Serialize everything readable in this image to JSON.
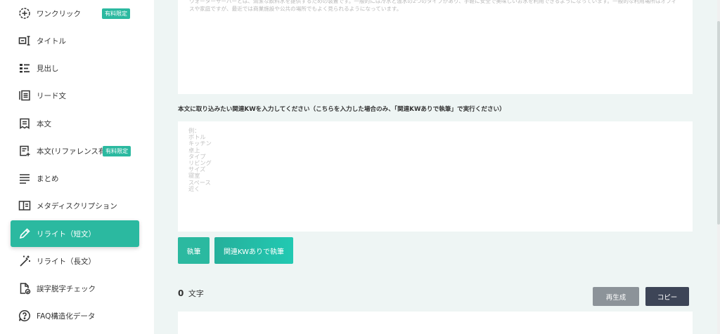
{
  "sidebar": {
    "items": [
      {
        "label": "ワンクリック",
        "icon": "plus-circle-icon",
        "badge": "有料限定"
      },
      {
        "label": "タイトル",
        "icon": "title-icon"
      },
      {
        "label": "見出し",
        "icon": "heading-list-icon"
      },
      {
        "label": "リード文",
        "icon": "lead-text-icon"
      },
      {
        "label": "本文",
        "icon": "document-icon"
      },
      {
        "label": "本文(リファレンス有)",
        "icon": "document-add-icon",
        "badge": "有料限定"
      },
      {
        "label": "まとめ",
        "icon": "summary-lines-icon"
      },
      {
        "label": "メタディスクリプション",
        "icon": "meta-description-icon"
      },
      {
        "label": "リライト（短文）",
        "icon": "pencil-icon",
        "active": true
      },
      {
        "label": "リライト（長文）",
        "icon": "magic-wand-icon"
      },
      {
        "label": "誤字脱字チェック",
        "icon": "file-check-icon"
      },
      {
        "label": "FAQ構造化データ",
        "icon": "faq-icon"
      }
    ],
    "accent_color": "#2bb9a0"
  },
  "main": {
    "top_textarea_text": "ウォーターサーバーとは、清潔な飲料水を提供するための装置です。一般的には冷水と温水の2つのタイプがあり、手軽に安全で美味しいお水を利用できるようになっています。一般的な利用場所はオフィスや家庭ですが、最近では商業施設や公共の場所でもよく見られるようになっています。",
    "kw_label": "本文に取り込みたい関連KWを入力してください（こちらを入力した場合のみ、「関連KWありで執筆」で実行ください）",
    "kw_placeholder_lines": [
      "例：",
      "ボトル",
      "キッチン",
      "卓上",
      "タイプ",
      "リビング",
      "サイズ",
      "寝室",
      "スペース",
      "近く"
    ],
    "write_button": "執筆",
    "write_kw_button": "関連KWありで執筆",
    "char_count": "0",
    "char_unit": "文字",
    "regenerate_button": "再生成",
    "copy_button": "コピー"
  }
}
